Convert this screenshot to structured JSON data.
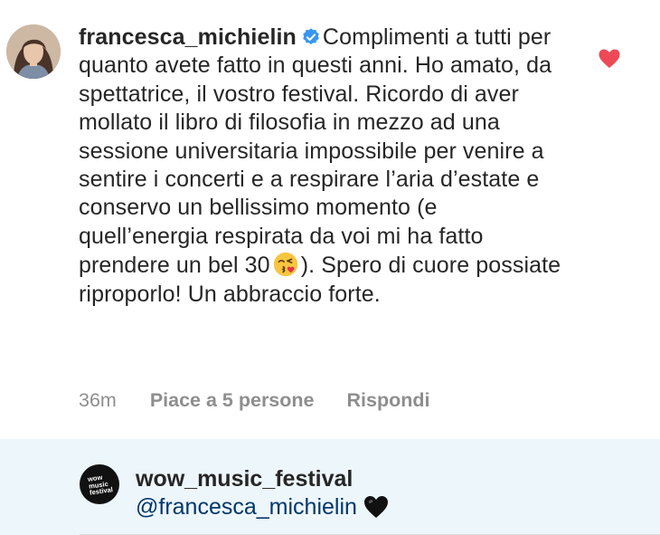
{
  "comment": {
    "username": "francesca_michielin",
    "avatar_icon": "profile-photo",
    "verified_icon": "verified-badge-icon",
    "text_part1": "Complimenti a tutti per quanto avete fatto in questi anni. Ho amato, da spettatrice, il vostro festival. Ricordo di aver mollato il libro di filosofia in mezzo ad una sessione universitaria impossibile per venire a sentire i concerti e a respirare l’aria d’estate e conservo un bellissimo momento (e quell’energia respirata da voi mi ha fatto prendere un bel 30",
    "emoji_icon": "face-blowing-kiss-emoji",
    "text_part2": "). Spero di cuore possiate riproporlo! Un abbraccio forte.",
    "liked": true,
    "like_icon": "heart-icon",
    "like_color": "#ed4956",
    "time": "36m",
    "likes_label": "Piace a 5 persone",
    "reply_label": "Rispondi"
  },
  "reply": {
    "username": "wow_music_festival",
    "avatar_icon": "wow-music-festival-logo",
    "logo_text": [
      "wow",
      "music",
      "festival"
    ],
    "mention": "@francesca_michielin",
    "emoji_icon": "black-heart-emoji",
    "background": "#edf6fb",
    "mention_color": "#00376b"
  }
}
